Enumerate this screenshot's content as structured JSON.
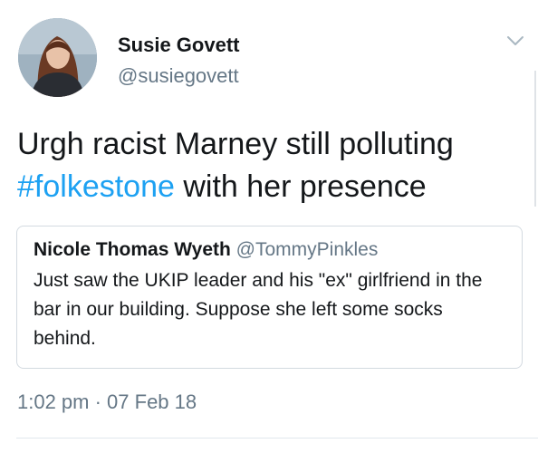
{
  "author": {
    "name": "Susie Govett",
    "handle": "@susiegovett"
  },
  "tweet": {
    "text_before": "Urgh racist Marney still polluting ",
    "hashtag": "#folkestone",
    "text_after": " with her presence"
  },
  "quoted_tweet": {
    "name": "Nicole Thomas Wyeth",
    "handle": "@TommyPinkles",
    "text": "Just saw the UKIP leader and his \"ex\" girlfriend in the bar in our building. Suppose she left some socks behind."
  },
  "timestamp": "1:02 pm · 07 Feb 18",
  "colors": {
    "text": "#14171a",
    "secondary": "#657786",
    "link": "#1da1f2",
    "border": "#d3dae0"
  },
  "icons": {
    "avatar": "avatar",
    "menu": "chevron-down-icon"
  }
}
